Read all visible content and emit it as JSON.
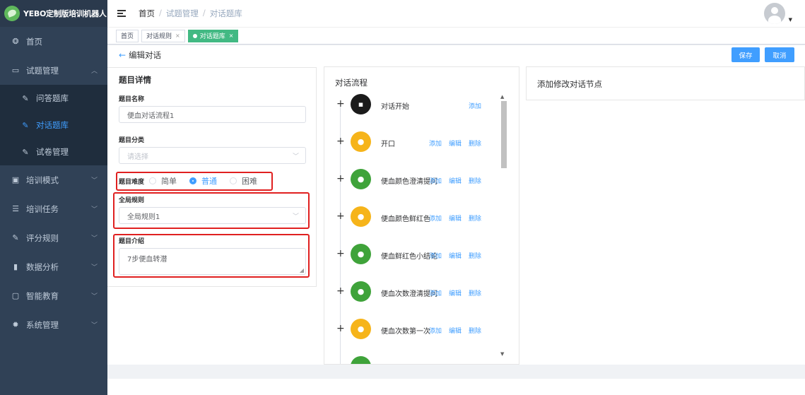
{
  "app": {
    "title": "YEBO定制版培训机器人"
  },
  "sidebar": {
    "items": [
      {
        "label": "首页",
        "icon": "dashboard-icon"
      },
      {
        "label": "试题管理",
        "icon": "book-icon",
        "expanded": true,
        "children": [
          {
            "label": "问答题库",
            "icon": "edit-icon"
          },
          {
            "label": "对话题库",
            "icon": "edit-icon",
            "active": true
          },
          {
            "label": "试卷管理",
            "icon": "edit-icon"
          }
        ]
      },
      {
        "label": "培训模式",
        "icon": "monitor-icon"
      },
      {
        "label": "培训任务",
        "icon": "list-icon"
      },
      {
        "label": "评分规则",
        "icon": "edit-icon"
      },
      {
        "label": "数据分析",
        "icon": "bar-chart-icon"
      },
      {
        "label": "智能教育",
        "icon": "screen-icon"
      },
      {
        "label": "系统管理",
        "icon": "gear-icon"
      }
    ]
  },
  "header": {
    "breadcrumb": [
      "首页",
      "试题管理",
      "对话题库"
    ],
    "separator": "/"
  },
  "tags": [
    {
      "label": "首页"
    },
    {
      "label": "对话规则",
      "closable": true
    },
    {
      "label": "对话题库",
      "closable": true,
      "active": true
    }
  ],
  "page": {
    "back_label": "编辑对话",
    "save_label": "保存",
    "cancel_label": "取消",
    "accent_color": "#409eff"
  },
  "details": {
    "title": "题目详情",
    "name_label": "题目名称",
    "name_value": "便血对话流程1",
    "category_label": "题目分类",
    "category_placeholder": "请选择",
    "difficulty_label": "题目难度",
    "difficulty_options": [
      "简单",
      "普通",
      "困难"
    ],
    "difficulty_selected": "普通",
    "rule_label": "全局规则",
    "rule_value": "全局规则1",
    "intro_label": "题目介绍",
    "intro_value": "7步便血转潜"
  },
  "flow": {
    "title": "对话流程",
    "add_label": "添加",
    "edit_label": "编辑",
    "delete_label": "删除",
    "nodes": [
      {
        "label": "对话开始",
        "icon": "chat-icon",
        "color": "black",
        "actions": [
          "添加"
        ]
      },
      {
        "label": "开口",
        "icon": "user-icon",
        "color": "yellow",
        "actions": [
          "添加",
          "编辑",
          "删除"
        ]
      },
      {
        "label": "便血颜色澄清提问",
        "icon": "doctor-icon",
        "color": "green",
        "actions": [
          "添加",
          "编辑",
          "删除"
        ]
      },
      {
        "label": "便血颜色鲜红色",
        "icon": "user-icon",
        "color": "yellow",
        "actions": [
          "添加",
          "编辑",
          "删除"
        ]
      },
      {
        "label": "便血鲜红色小结论",
        "icon": "doctor-icon",
        "color": "green",
        "actions": [
          "添加",
          "编辑",
          "删除"
        ]
      },
      {
        "label": "便血次数澄清提问",
        "icon": "doctor-icon",
        "color": "green",
        "actions": [
          "添加",
          "编辑",
          "删除"
        ]
      },
      {
        "label": "便血次数第一次",
        "icon": "user-icon",
        "color": "yellow",
        "actions": [
          "添加",
          "编辑",
          "删除"
        ]
      }
    ]
  },
  "node_editor": {
    "title": "添加修改对话节点"
  }
}
